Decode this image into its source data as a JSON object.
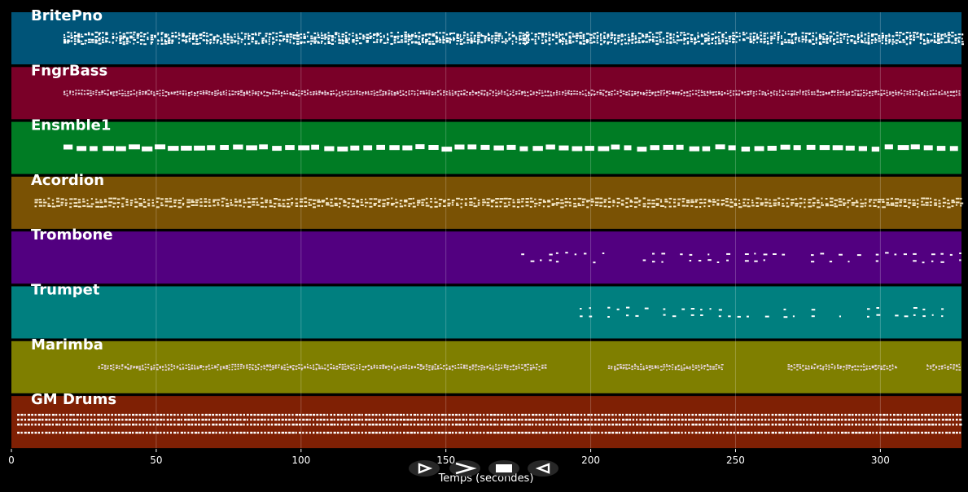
{
  "chart_data": {
    "type": "pianoroll",
    "xlabel": "Temps (secondes)",
    "xlim": [
      0,
      328
    ],
    "xticks": [
      0,
      50,
      100,
      150,
      200,
      250,
      300
    ],
    "grid": true,
    "tracks": [
      {
        "name": "BritePno",
        "color": "#005478",
        "segments": [
          [
            18,
            178,
            "dense"
          ],
          [
            177,
            190,
            "dense"
          ],
          [
            190,
            328,
            "dense"
          ]
        ]
      },
      {
        "name": "FngrBass",
        "color": "#7a0028",
        "segments": [
          [
            18,
            328,
            "light"
          ]
        ]
      },
      {
        "name": "Ensmble1",
        "color": "#007c24",
        "segments": [
          [
            18,
            328,
            "block"
          ]
        ]
      },
      {
        "name": "Acordion",
        "color": "#7a5204",
        "segments": [
          [
            8,
            328,
            "medium"
          ]
        ]
      },
      {
        "name": "Trombone",
        "color": "#520080",
        "segments": [
          [
            176,
            186,
            "sparse"
          ],
          [
            188,
            206,
            "sparse"
          ],
          [
            218,
            268,
            "sparse"
          ],
          [
            276,
            328,
            "sparse"
          ]
        ]
      },
      {
        "name": "Trumpet",
        "color": "#007f7f",
        "segments": [
          [
            193,
            328,
            "sparse"
          ]
        ]
      },
      {
        "name": "Marimba",
        "color": "#7f7f00",
        "segments": [
          [
            30,
            185,
            "light"
          ],
          [
            206,
            246,
            "light"
          ],
          [
            268,
            306,
            "light"
          ],
          [
            316,
            328,
            "light"
          ]
        ]
      },
      {
        "name": "GM Drums",
        "color": "#7f2004",
        "segments": [
          [
            2,
            328,
            "drums"
          ]
        ]
      }
    ]
  },
  "player": {
    "buttons": [
      {
        "id": "play",
        "icon": "play-icon"
      },
      {
        "id": "fast-forward",
        "icon": "fast-forward-icon"
      },
      {
        "id": "stop",
        "icon": "stop-icon"
      },
      {
        "id": "rewind",
        "icon": "rewind-icon"
      }
    ]
  }
}
